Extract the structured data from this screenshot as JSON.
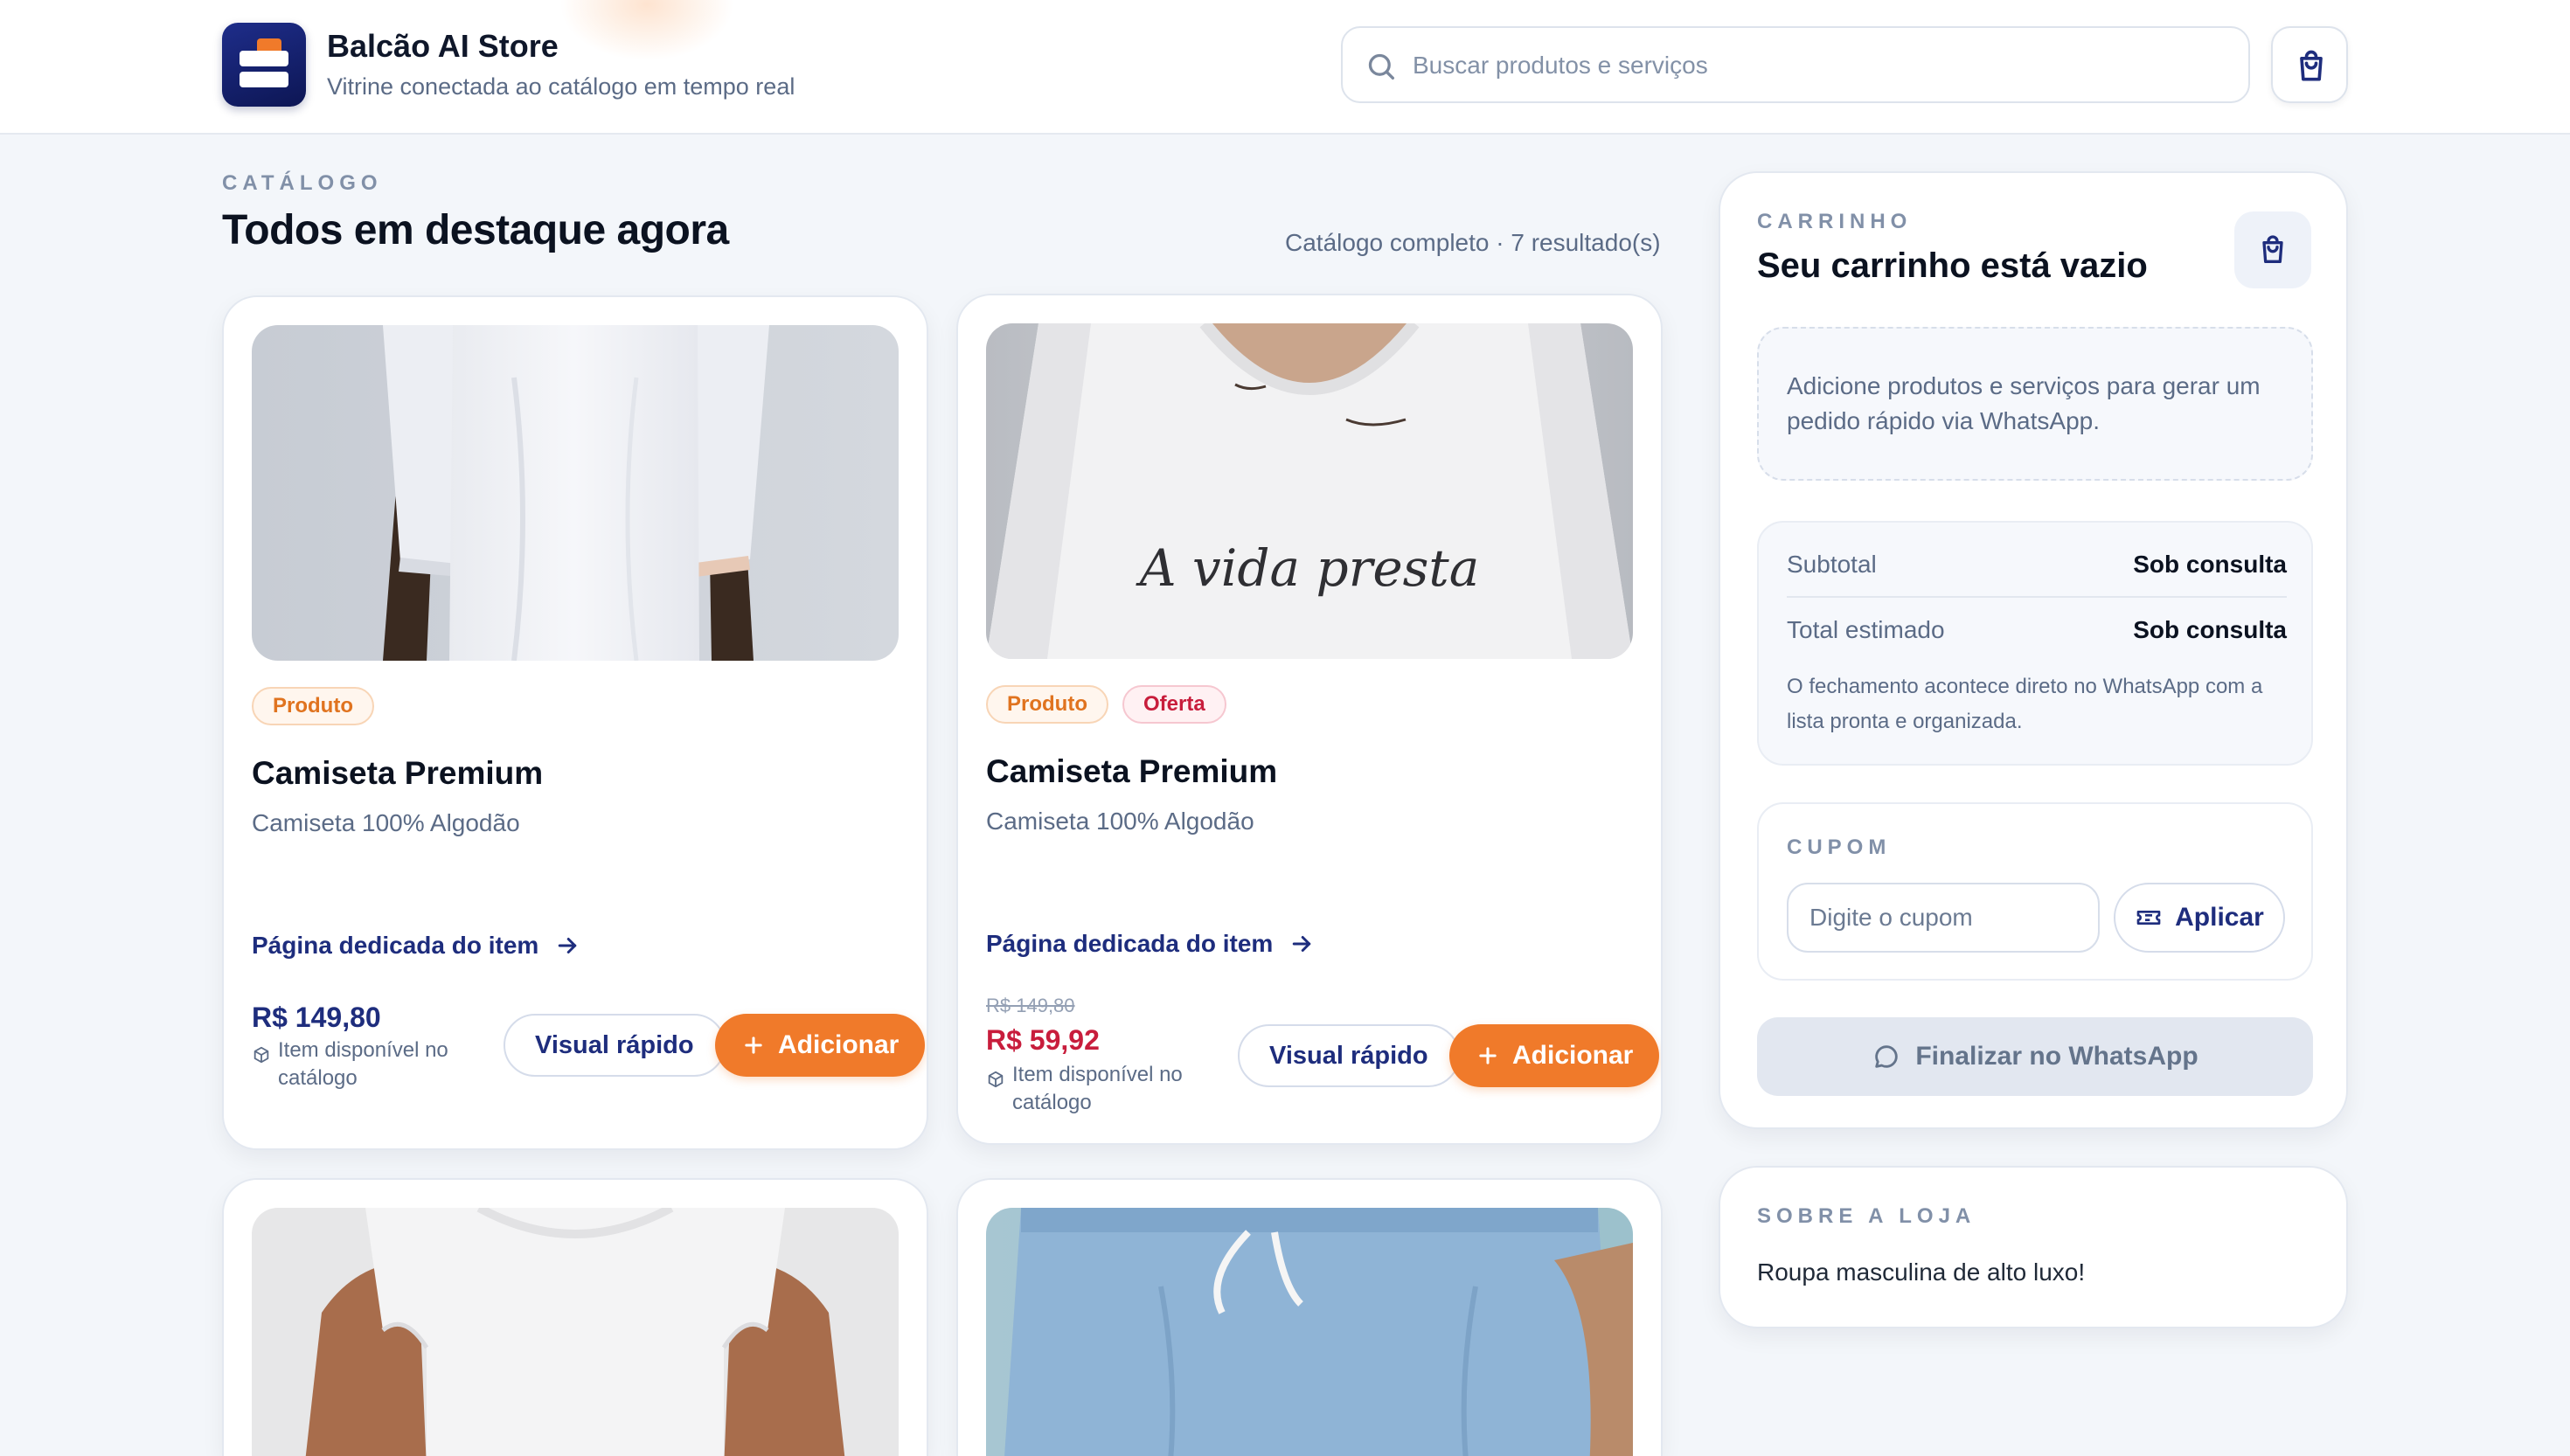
{
  "header": {
    "brand_name": "Balcão AI Store",
    "brand_subtitle": "Vitrine conectada ao catálogo em tempo real",
    "search_placeholder": "Buscar produtos e serviços",
    "search_value": ""
  },
  "catalog": {
    "eyebrow": "CATÁLOGO",
    "title": "Todos em destaque agora",
    "count_text": "Catálogo completo · 7 resultado(s)"
  },
  "products": [
    {
      "badges": [
        "Produto"
      ],
      "title": "Camiseta Premium",
      "description": "Camiseta 100% Algodão",
      "link_label": "Página dedicada do item",
      "old_price": "",
      "price": "R$ 149,80",
      "availability": "Item disponível no catálogo",
      "quick_view_label": "Visual rápido",
      "add_label": "Adicionar"
    },
    {
      "badges": [
        "Produto",
        "Oferta"
      ],
      "title": "Camiseta Premium",
      "description": "Camiseta 100% Algodão",
      "link_label": "Página dedicada do item",
      "old_price": "R$ 149,80",
      "price": "R$ 59,92",
      "availability": "Item disponível no catálogo",
      "quick_view_label": "Visual rápido",
      "add_label": "Adicionar",
      "shirt_print": "A vida presta"
    }
  ],
  "cart": {
    "eyebrow": "CARRINHO",
    "title": "Seu carrinho está vazio",
    "empty_message": "Adicione produtos e serviços para gerar um pedido rápido via WhatsApp.",
    "subtotal_label": "Subtotal",
    "subtotal_value": "Sob consulta",
    "total_label": "Total estimado",
    "total_value": "Sob consulta",
    "note": "O fechamento acontece direto no WhatsApp com a lista pronta e organizada.",
    "coupon_eyebrow": "CUPOM",
    "coupon_placeholder": "Digite o cupom",
    "coupon_apply_label": "Aplicar",
    "checkout_label": "Finalizar no WhatsApp"
  },
  "about": {
    "eyebrow": "SOBRE A LOJA",
    "text": "Roupa masculina de alto luxo!"
  },
  "colors": {
    "accent": "#f07a2a",
    "brand_navy": "#1e2d7d",
    "sale": "#c81d3c",
    "background": "#f3f6fa"
  },
  "icons": {
    "search": "search-icon",
    "cart": "shopping-bag-icon",
    "arrow": "arrow-right-icon",
    "package": "package-icon",
    "plus": "plus-icon",
    "ticket": "ticket-icon",
    "chat": "chat-bubble-icon"
  }
}
